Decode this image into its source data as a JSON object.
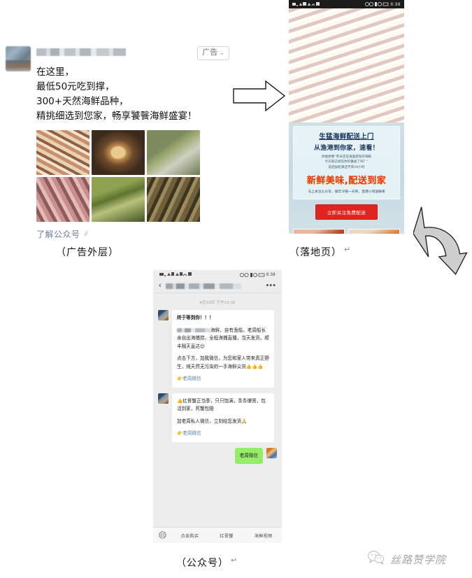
{
  "ad_outer": {
    "advertiser_name_redacted": "",
    "ad_tag_label": "广告",
    "chevron": "⌄",
    "body_lines": [
      "在这里，",
      "最低50元吃到撑，",
      "300+天然海鲜品种，",
      "精挑细选到您家，畅享饕餮海鲜盛宴！"
    ],
    "thumbnails": [
      "mantis-shrimp-photo",
      "abalone-photo",
      "flounder-crab-photo",
      "squid-photo",
      "green-crab-photo",
      "mud-crab-photo"
    ],
    "cta_link": "了解公众号",
    "link_icon": "◌",
    "caption": "（广告外层）"
  },
  "landing_page": {
    "status_bar": {
      "left_icons": "signal-wifi-icons",
      "right_icons": "battery-alarm-icons",
      "time": "8:38"
    },
    "hero_image": "mantis-shrimp-hero-photo",
    "promo": {
      "headline1": "生猛海鲜配送上门",
      "headline2": "从渔港到你家，速看！",
      "sub_lines": [
        "你能想像“昨天还在海里游动的海鲜",
        "今天就已经在你的餐桌了吗？”",
        "前后加起来还不到24小时"
      ],
      "big_text": "新鲜美味,配送到家",
      "foot_line": "马上关注公众号，顺丰冷链一天到，渔港小哥送鲜来",
      "cta_label": "立即关注免费配送",
      "cta_color": "#e02520"
    },
    "gallery": [
      "steamed-crab-photo",
      "seafood-dish-photo"
    ],
    "caption": "（落地页）"
  },
  "official_account": {
    "status_bar": {
      "left_icons": "signal-wifi-icons",
      "right_icons": "battery-alarm-icons",
      "time": "8:38"
    },
    "nav": {
      "back_icon": "‹",
      "title_redacted": "",
      "more_icon": "•••"
    },
    "timestamp": "4月13日 下午15:32",
    "messages": [
      {
        "direction": "in",
        "paragraphs": [
          "终于等到你！！！",
          "海鲜，自有渔船，老周船长亲自出海捕捞，全程海捕直播，当天发货，顺丰隔天直达😊",
          "点击下方，加我微信，为您和家人带来真正野生，纯天然无污染的一手海鲜尖货👍👍👍",
          "👉老周微信"
        ]
      },
      {
        "direction": "in",
        "paragraphs": [
          "👍红膏蟹正当季，只只饱满，条条爆膏，包活到家，死蟹包赔",
          "加老周私人微信，立刻给您发货🙏",
          "👉老周微信"
        ]
      },
      {
        "direction": "out",
        "paragraphs": [
          "老周微信"
        ]
      }
    ],
    "bottom_nav": {
      "keyboard_icon": "⌨",
      "items": [
        "点击购买",
        "红膏蟹",
        "海鲜视频"
      ]
    },
    "caption": "（公众号）"
  },
  "arrows": {
    "right_arrow": "straight-right-arrow",
    "curved_arrow": "curved-down-left-arrow"
  },
  "watermark": {
    "icon": "wechat-icon",
    "text": "丝路赞学院"
  }
}
